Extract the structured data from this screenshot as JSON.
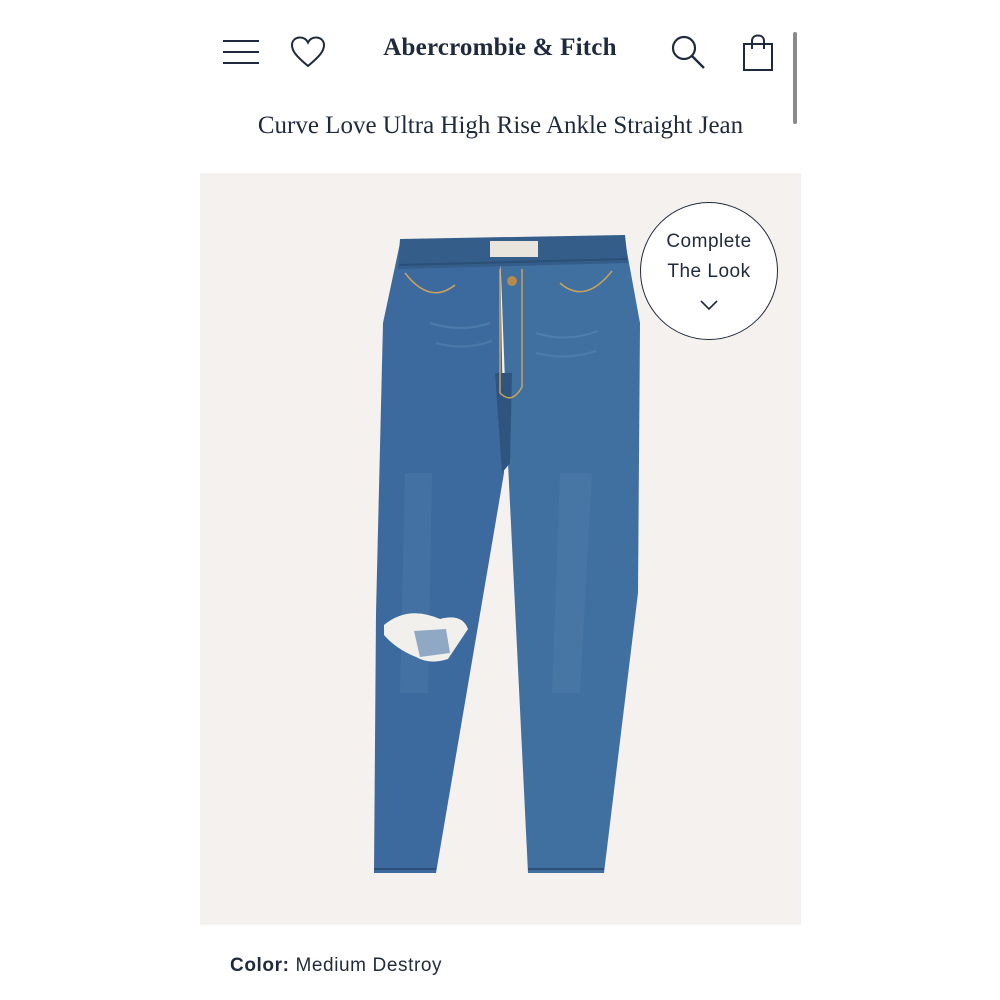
{
  "header": {
    "brand": "Abercrombie & Fitch",
    "icons": [
      "menu-icon",
      "heart-icon",
      "search-icon",
      "shopping-bag-icon"
    ]
  },
  "product": {
    "title": "Curve Love Ultra High Rise Ankle Straight Jean",
    "image_alt": "Medium wash straight leg jeans with ripped knee",
    "complete_the_look": {
      "line1": "Complete",
      "line2": "The Look"
    },
    "color_label": "Color:",
    "color_value": "Medium Destroy"
  },
  "colors": {
    "text_navy": "#1f2a3d",
    "image_background": "#f4f1ef",
    "denim": "#3d6a9e"
  }
}
